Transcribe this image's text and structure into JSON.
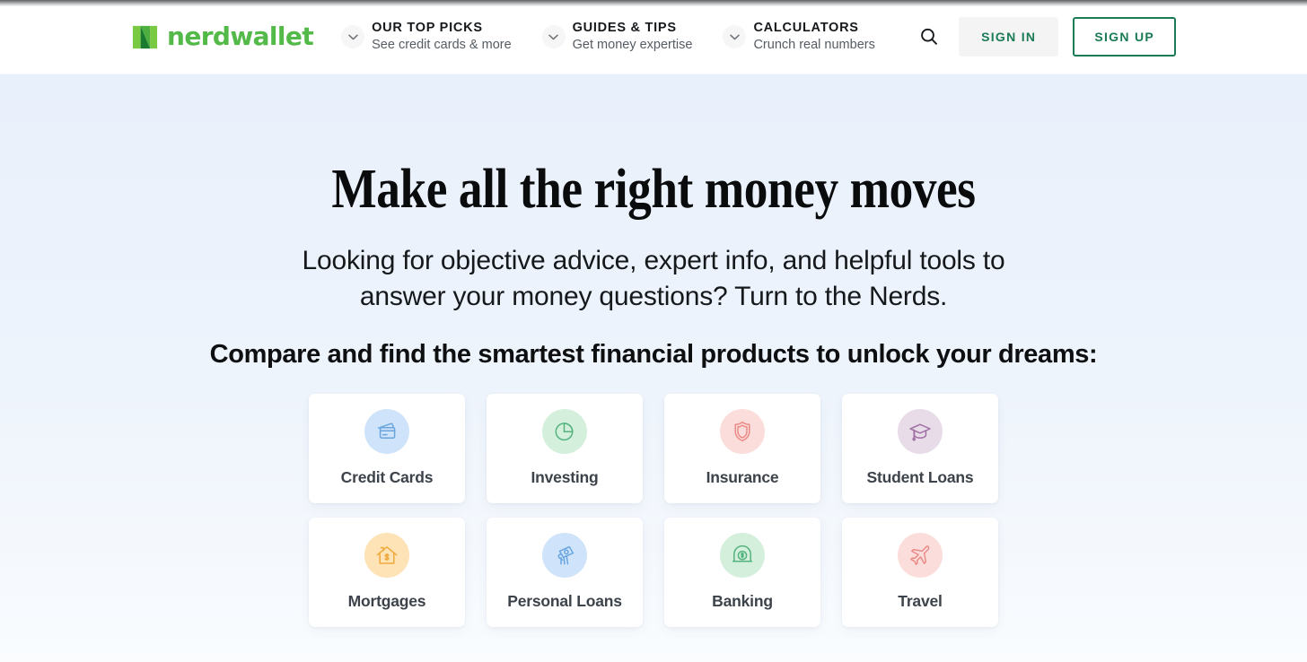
{
  "header": {
    "logo": {
      "name": "nerdwallet",
      "mark_light": "#7ac943",
      "mark_dark": "#197b30",
      "word_color": "#53b948"
    },
    "nav_items": [
      {
        "title": "OUR TOP PICKS",
        "subtitle": "See credit cards & more"
      },
      {
        "title": "GUIDES & TIPS",
        "subtitle": "Get money expertise"
      },
      {
        "title": "CALCULATORS",
        "subtitle": "Crunch real numbers"
      }
    ],
    "search_icon": "search-icon",
    "sign_in_label": "SIGN IN",
    "sign_up_label": "SIGN UP",
    "accent_green": "#1a7b54"
  },
  "hero": {
    "title": "Make all the right money moves",
    "subtitle": "Looking for objective advice, expert info, and helpful tools to answer your money questions? Turn to the Nerds.",
    "cta_line": "Compare and find the smartest financial products to unlock your dreams:"
  },
  "product_cards": [
    {
      "label": "Credit Cards",
      "icon": "credit-cards-icon",
      "circle_color": "#cfe4fa",
      "stroke_color": "#6aa5e0"
    },
    {
      "label": "Investing",
      "icon": "pie-chart-icon",
      "circle_color": "#d4f0dd",
      "stroke_color": "#54b37e"
    },
    {
      "label": "Insurance",
      "icon": "shield-icon",
      "circle_color": "#fbdedc",
      "stroke_color": "#eb8a86"
    },
    {
      "label": "Student Loans",
      "icon": "graduation-cap-icon",
      "circle_color": "#e8dce8",
      "stroke_color": "#a070a5"
    },
    {
      "label": "Mortgages",
      "icon": "house-dollar-icon",
      "circle_color": "#fde3b6",
      "stroke_color": "#f0a93c"
    },
    {
      "label": "Personal Loans",
      "icon": "hand-cash-icon",
      "circle_color": "#cfe4fa",
      "stroke_color": "#6aa5e0"
    },
    {
      "label": "Banking",
      "icon": "coin-dollar-icon",
      "circle_color": "#d4f0dd",
      "stroke_color": "#54b37e"
    },
    {
      "label": "Travel",
      "icon": "airplane-icon",
      "circle_color": "#fbdedc",
      "stroke_color": "#eb8a86"
    }
  ]
}
